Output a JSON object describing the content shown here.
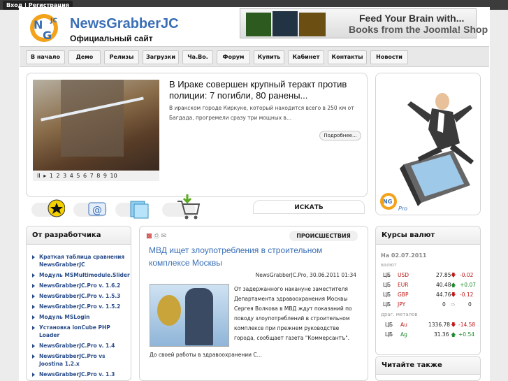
{
  "topbar": {
    "login_label": "Вход | Регистрация"
  },
  "header": {
    "site_name": "NewsGrabberJC",
    "site_subtitle": "Официальный сайт",
    "banner_line1": "Feed Your Brain with...",
    "banner_line2": "Books from the Joomla! Shop"
  },
  "nav": {
    "items": [
      "В начало",
      "Демо",
      "Релизы",
      "Загрузки",
      "Ча.Во.",
      "Форум",
      "Купить",
      "Кабинет",
      "Контакты",
      "Новости"
    ]
  },
  "featured": {
    "title": "В Ираке совершен крупный теракт против полиции: 7 погибли, 80 ранены...",
    "text": "В иракском городе Киркуке, который находится всего в 250 км от Багдада, прогремели сразу три мощных в...",
    "more_label": "Подробнее...",
    "pager": "II ▸ 1 2 3 4 5 6 7 8 9 10"
  },
  "search": {
    "tab_label": "ИСКАТЬ"
  },
  "developer": {
    "title": "От разработчика",
    "items": [
      "Краткая таблица сравнения NewsGrabberJC",
      "Модуль MSMultimodule.Slider",
      "NewsGrabberJC.Pro v. 1.6.2",
      "NewsGrabberJC.Pro v. 1.5.3",
      "NewsGrabberJC.Pro v. 1.5.2",
      "Модуль MSLogin",
      "Установка ionCube PHP Loader",
      "NewsGrabberJC.Pro v. 1.4",
      "NewsGrabberJC.Pro vs Joostina 1.2.x",
      "NewsGrabberJC.Pro v. 1.3"
    ]
  },
  "article": {
    "category": "ПРОИСШЕСТВИЯ",
    "title": "МВД ищет злоупотребления в строительном комплексе Москвы",
    "meta": "NewsGrabberJC.Pro, 30.06.2011 01:34",
    "text": "От задержанного накануне заместителя Департамента здравоохранения Москвы Сергея Волкова в МВД ждут показаний по поводу злоупотреблений в строительном комплексе при прежнем руководстве города, сообщает газета \"Коммерсантъ\".",
    "text2": "До своей работы в здравоохранении С..."
  },
  "rates": {
    "title": "Курсы валют",
    "date": "На 02.07.2011",
    "currency_label": "валют",
    "metals_label": "драг. металов",
    "rows": [
      {
        "bank": "ЦБ",
        "code": "USD",
        "value": "27.85",
        "dir": "down",
        "change": "-0.02"
      },
      {
        "bank": "ЦБ",
        "code": "EUR",
        "value": "40.48",
        "dir": "up",
        "change": "+0.07"
      },
      {
        "bank": "ЦБ",
        "code": "GBP",
        "value": "44.76",
        "dir": "down",
        "change": "-0.12"
      },
      {
        "bank": "ЦБ",
        "code": "JPY",
        "value": "0",
        "dir": "same",
        "change": "0"
      }
    ],
    "metals": [
      {
        "bank": "ЦБ",
        "code": "Au",
        "value": "1336.78",
        "dir": "down",
        "change": "-14.58"
      },
      {
        "bank": "ЦБ",
        "code": "Ag",
        "value": "31.36",
        "dir": "up",
        "change": "+0.54"
      }
    ]
  },
  "also": {
    "title": "Читайте также"
  },
  "colors": {
    "accent": "#3a6fb6",
    "up": "#1a8a2a",
    "down": "#c01818"
  }
}
